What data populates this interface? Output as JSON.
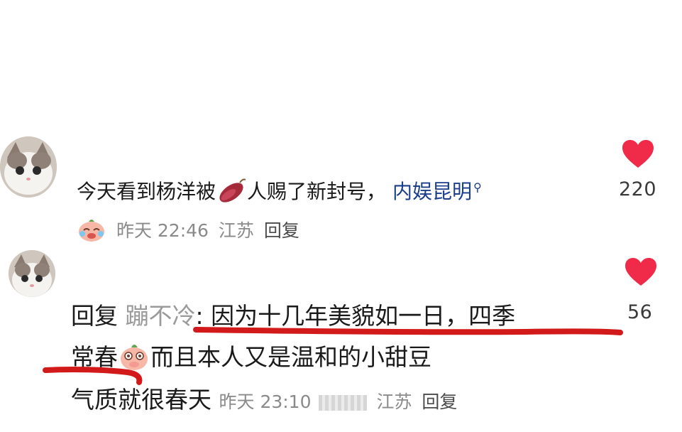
{
  "comment1": {
    "text_before": "今天看到杨洋被",
    "emoji": "sweet-potato-icon",
    "text_after": "人赐了新封号，",
    "topic_link": "内娱昆明",
    "likes": "220",
    "time": "昨天 22:46",
    "location": "江苏",
    "reply_label": "回复"
  },
  "comment2": {
    "reply_prefix": "回复",
    "reply_to_user": "蹦不冷",
    "line1": ": 因为十几年美貌如一日，四季",
    "line2_a": "常春",
    "line2_b": "而且本人又是温和的小甜豆",
    "line3": "气质就很春天",
    "likes": "56",
    "time": "昨天 23:10",
    "location": "江苏",
    "reply_label": "回复"
  },
  "colors": {
    "heart": "#ef2b49",
    "underline": "#d31a1a",
    "link": "#1a3e8c",
    "meta": "#8a8a8a"
  }
}
